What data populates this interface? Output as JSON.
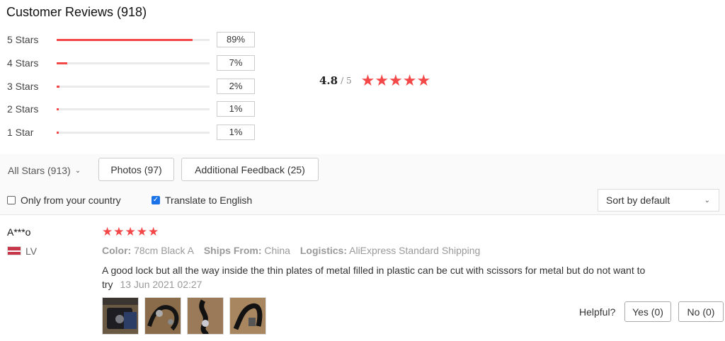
{
  "header": {
    "title": "Customer Reviews (918)"
  },
  "distribution": [
    {
      "label": "5 Stars",
      "percent_text": "89%",
      "fill": 0.89
    },
    {
      "label": "4 Stars",
      "percent_text": "7%",
      "fill": 0.07
    },
    {
      "label": "3 Stars",
      "percent_text": "2%",
      "fill": 0.02
    },
    {
      "label": "2 Stars",
      "percent_text": "1%",
      "fill": 0.01
    },
    {
      "label": "1 Star",
      "percent_text": "1%",
      "fill": 0.01
    }
  ],
  "overall": {
    "score": "4.8",
    "out_of": "/ 5",
    "stars": "★★★★★"
  },
  "filters": {
    "all_stars": "All Stars (913)",
    "photos": "Photos (97)",
    "additional": "Additional Feedback (25)",
    "only_country": "Only from your country",
    "only_country_checked": false,
    "translate": "Translate to English",
    "translate_checked": true,
    "sort": "Sort by default"
  },
  "review": {
    "name": "A***o",
    "country": "LV",
    "stars": "★★★★★",
    "color_key": "Color:",
    "color_val": "78cm Black A",
    "ships_key": "Ships From:",
    "ships_val": "China",
    "logistics_key": "Logistics:",
    "logistics_val": "AliExpress Standard Shipping",
    "text": "A good lock but all the way inside the thin plates of metal filled in plastic can be cut with scissors for metal but do not want to try",
    "date": "13 Jun 2021 02:27",
    "helpful_label": "Helpful?",
    "yes_label": "Yes (0)",
    "no_label": "No (0)"
  },
  "colors": {
    "accent": "#f44747",
    "check": "#1a73e8"
  },
  "icons": {
    "dropdown": "chevron-down-icon",
    "star": "star-icon",
    "flag": "flag-icon"
  }
}
